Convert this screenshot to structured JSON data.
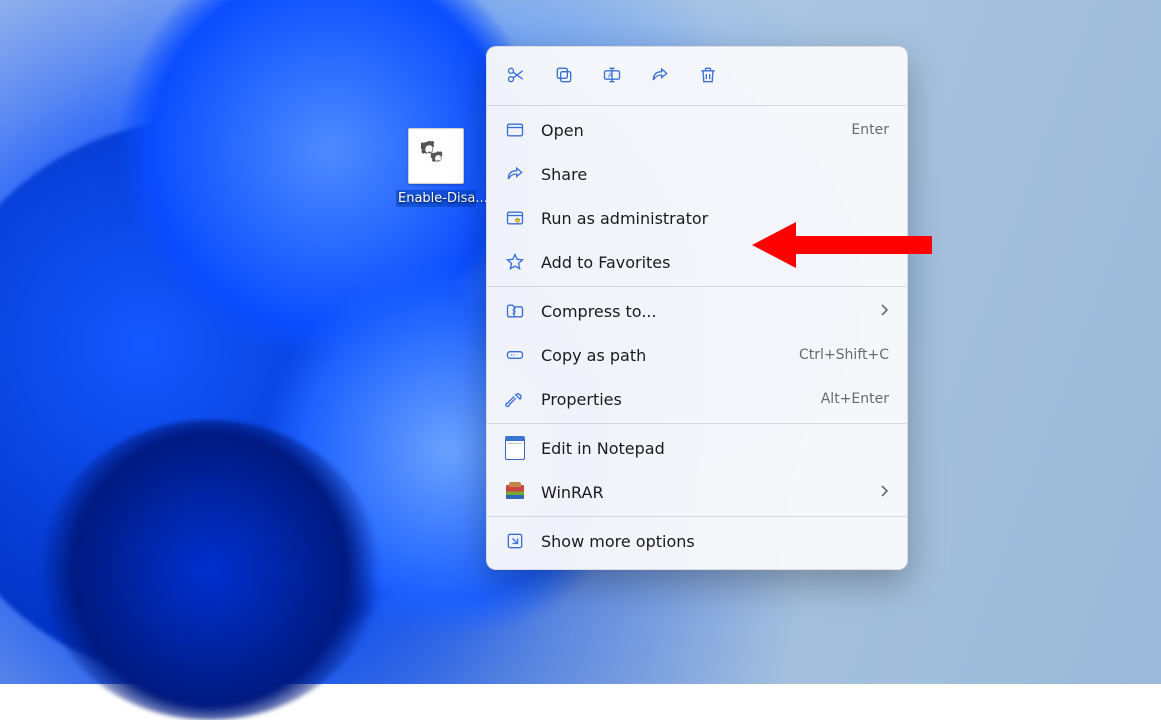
{
  "desktop": {
    "icon_label": "Enable-Disa..."
  },
  "context_menu": {
    "actions": {
      "cut": "Cut",
      "copy": "Copy",
      "rename": "Rename",
      "share": "Share",
      "delete": "Delete"
    },
    "items": {
      "open": {
        "label": "Open",
        "accel": "Enter",
        "icon": "app-window-icon"
      },
      "share": {
        "label": "Share",
        "accel": "",
        "icon": "share-icon"
      },
      "run_admin": {
        "label": "Run as administrator",
        "accel": "",
        "icon": "shield-run-icon"
      },
      "favorites": {
        "label": "Add to Favorites",
        "accel": "",
        "icon": "star-icon"
      },
      "compress": {
        "label": "Compress to...",
        "accel": "",
        "icon": "zip-folder-icon",
        "submenu": true
      },
      "copy_path": {
        "label": "Copy as path",
        "accel": "Ctrl+Shift+C",
        "icon": "path-icon"
      },
      "properties": {
        "label": "Properties",
        "accel": "Alt+Enter",
        "icon": "wrench-icon"
      },
      "notepad": {
        "label": "Edit in Notepad",
        "accel": "",
        "icon": "notepad-icon"
      },
      "winrar": {
        "label": "WinRAR",
        "accel": "",
        "icon": "winrar-icon",
        "submenu": true
      },
      "more": {
        "label": "Show more options",
        "accel": "",
        "icon": "expand-icon"
      }
    }
  },
  "annotation": {
    "points_to": "run_admin",
    "color": "#ff0000"
  }
}
